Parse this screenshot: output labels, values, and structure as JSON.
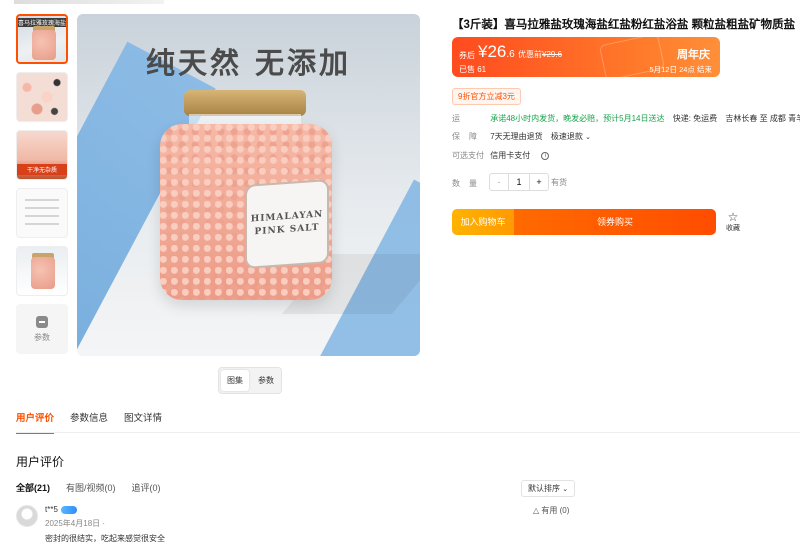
{
  "gallery": {
    "thumbs": [
      {
        "caption": "喜马拉雅玫瑰海盐"
      },
      {
        "caption": ""
      },
      {
        "caption": "干净无杂质"
      },
      {
        "caption": ""
      },
      {
        "caption": ""
      }
    ],
    "params_thumb_label": "参数",
    "main_headline": "纯天然  无添加",
    "jar_label_lines": [
      "HIMALAYAN",
      "PINK SALT"
    ],
    "toggle": [
      "图集",
      "参数"
    ]
  },
  "product": {
    "title": "【3斤装】喜马拉雅盐玫瑰海盐红盐粉红盐浴盐 颗粒盐粗盐矿物质盐",
    "price": {
      "label": "券后",
      "currency": "¥",
      "integer": "26",
      "decimal": ".6",
      "orig_label": "优惠前",
      "orig_value": "¥29.6",
      "sold": "已售 61",
      "event": "周年庆",
      "end": "5月12日 24点 结束"
    },
    "coupon": "9折官方立减3元",
    "shipping": {
      "key": "运",
      "promise": "承诺48小时内发货，晚发必赔，预计5月14日送达",
      "fee": "快递: 免运费",
      "route": "吉林长春 至 成都 青羊"
    },
    "guarantee": {
      "key": "保障",
      "items": [
        "7天无理由退货",
        "极速退款"
      ]
    },
    "payment": {
      "key": "可选支付",
      "value": "信用卡支付"
    },
    "quantity": {
      "key": "数量",
      "minus": "-",
      "value": "1",
      "plus": "+",
      "stock": "有货"
    },
    "buttons": {
      "add_cart": "加入购物车",
      "buy": "领券购买",
      "favorite": "收藏"
    }
  },
  "tabs": [
    "用户评价",
    "参数信息",
    "图文详情"
  ],
  "reviews": {
    "title": "用户评价",
    "filters": [
      "全部(21)",
      "有图/视频(0)",
      "追评(0)"
    ],
    "sort": "默认排序",
    "items": [
      {
        "user": "t**5",
        "date": "2025年4月18日 ·",
        "text": "密封的很结实，吃起来感觉很安全",
        "helpful": "有用 (0)"
      }
    ]
  },
  "colors": {
    "accent": "#ff5000",
    "price_gradient_start": "#ff4b1f",
    "shipping_green": "#16a34a"
  }
}
